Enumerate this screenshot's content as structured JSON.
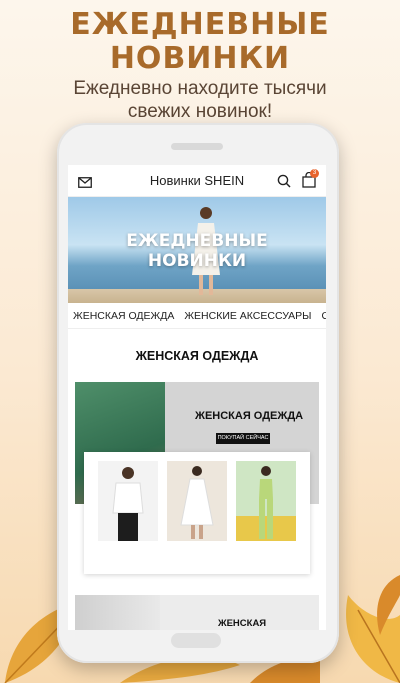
{
  "promo": {
    "title_line1": "ЕЖЕДНЕВНЫЕ",
    "title_line2": "НОВИНКИ",
    "subtitle_line1": "Ежедневно находите тысячи",
    "subtitle_line2": "свежих новинок!"
  },
  "appbar": {
    "title": "Новинки SHEIN",
    "cart_count": "3",
    "icons": [
      "mail-icon",
      "search-icon",
      "bag-icon"
    ]
  },
  "banner": {
    "line1": "ЕЖЕДНЕВНЫЕ",
    "line2": "НОВИНКИ"
  },
  "categories": [
    "ЖЕНСКАЯ ОДЕЖДА",
    "ЖЕНСКИЕ АКСЕССУАРЫ",
    "ОДЕ"
  ],
  "section": {
    "title": "ЖЕНСКАЯ ОДЕЖДА"
  },
  "hero_card": {
    "label": "ЖЕНСКАЯ ОДЕЖДА",
    "button": "ПОКУПАЙ СЕЙЧАС"
  },
  "bottom_card": {
    "label": "ЖЕНСКАЯ"
  },
  "colors": {
    "promo_title": "#a86a2a",
    "badge": "#e8642d",
    "background": "#fbe9d2"
  }
}
